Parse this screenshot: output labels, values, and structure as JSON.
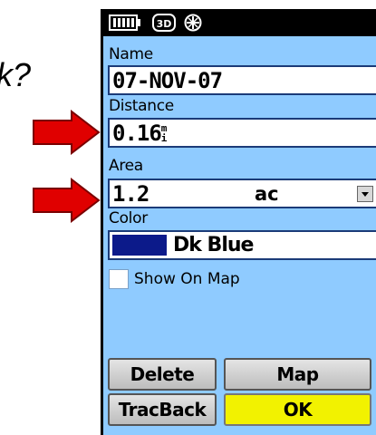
{
  "slide_text": "k?",
  "status_bar": {
    "icons": [
      "battery-icon",
      "3d-fix-icon",
      "satellite-icon"
    ],
    "fix_label": "3D"
  },
  "form": {
    "name_label": "Name",
    "name_value": "07-NOV-07",
    "distance_label": "Distance",
    "distance_value": "0.16",
    "distance_unit": "m",
    "distance_unit_sub": "i",
    "area_label": "Area",
    "area_value": "1.2",
    "area_unit": "ac",
    "color_label": "Color",
    "color_value": "Dk Blue",
    "color_swatch": "#0c1a8a",
    "show_on_map_label": "Show On Map",
    "show_on_map_checked": false
  },
  "buttons": {
    "delete": "Delete",
    "map": "Map",
    "tracback": "TracBack",
    "ok": "OK"
  },
  "colors": {
    "device_background": "#8fcbff",
    "arrow": "#e00000",
    "ok_button": "#f2f200"
  }
}
